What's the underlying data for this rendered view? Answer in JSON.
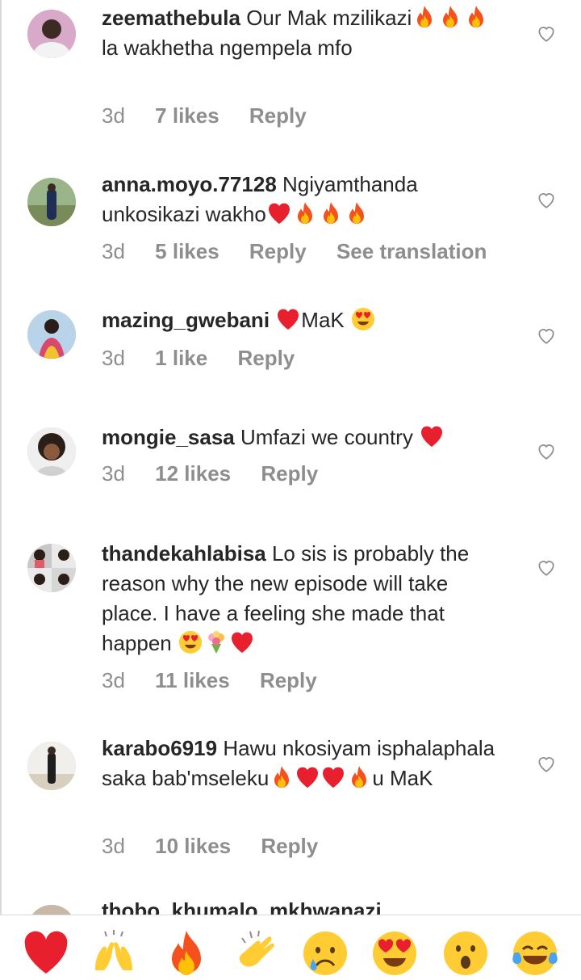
{
  "comments": [
    {
      "username": "zeemathebula",
      "segments": [
        "Our Mak mzilikazi",
        "fire",
        "fire",
        "fire",
        " la wakhetha ngempela mfo"
      ],
      "time": "3d",
      "likes": "7 likes",
      "reply": "Reply"
    },
    {
      "username": "anna.moyo.77128",
      "segments": [
        "Ngiyamthanda unkosikazi wakho",
        "heart",
        "fire",
        "fire",
        "fire"
      ],
      "time": "3d",
      "likes": "5 likes",
      "reply": "Reply",
      "translate": "See translation"
    },
    {
      "username": "mazing_gwebani",
      "segments": [
        "heart",
        "MaK ",
        "heart-eyes"
      ],
      "time": "3d",
      "likes": "1 like",
      "reply": "Reply"
    },
    {
      "username": "mongie_sasa",
      "segments": [
        "Umfazi we country ",
        "heart"
      ],
      "time": "3d",
      "likes": "12 likes",
      "reply": "Reply"
    },
    {
      "username": "thandekahlabisa",
      "segments": [
        "Lo sis is probably the reason why the new episode will take place. I have a feeling she made that happen ",
        "heart-eyes",
        "bouquet",
        "heart"
      ],
      "time": "3d",
      "likes": "11 likes",
      "reply": "Reply"
    },
    {
      "username": "karabo6919",
      "segments": [
        "Hawu nkosiyam isphalaphala saka bab'mseleku",
        "fire",
        "heart",
        "heart",
        "fire",
        "u MaK"
      ],
      "time": "3d",
      "likes": "10 likes",
      "reply": "Reply"
    }
  ],
  "partial_comment": {
    "username": "thobo_khumalo_mkhwanazi"
  },
  "reactions": [
    "heart",
    "raised-hands",
    "fire",
    "clapping-hands",
    "sad-face",
    "heart-eyes",
    "surprised-face",
    "tears-of-joy"
  ],
  "colors": {
    "text": "#262626",
    "meta": "#8e8e8e",
    "heart_red": "#e8202e",
    "divider": "#dbdbdb"
  }
}
